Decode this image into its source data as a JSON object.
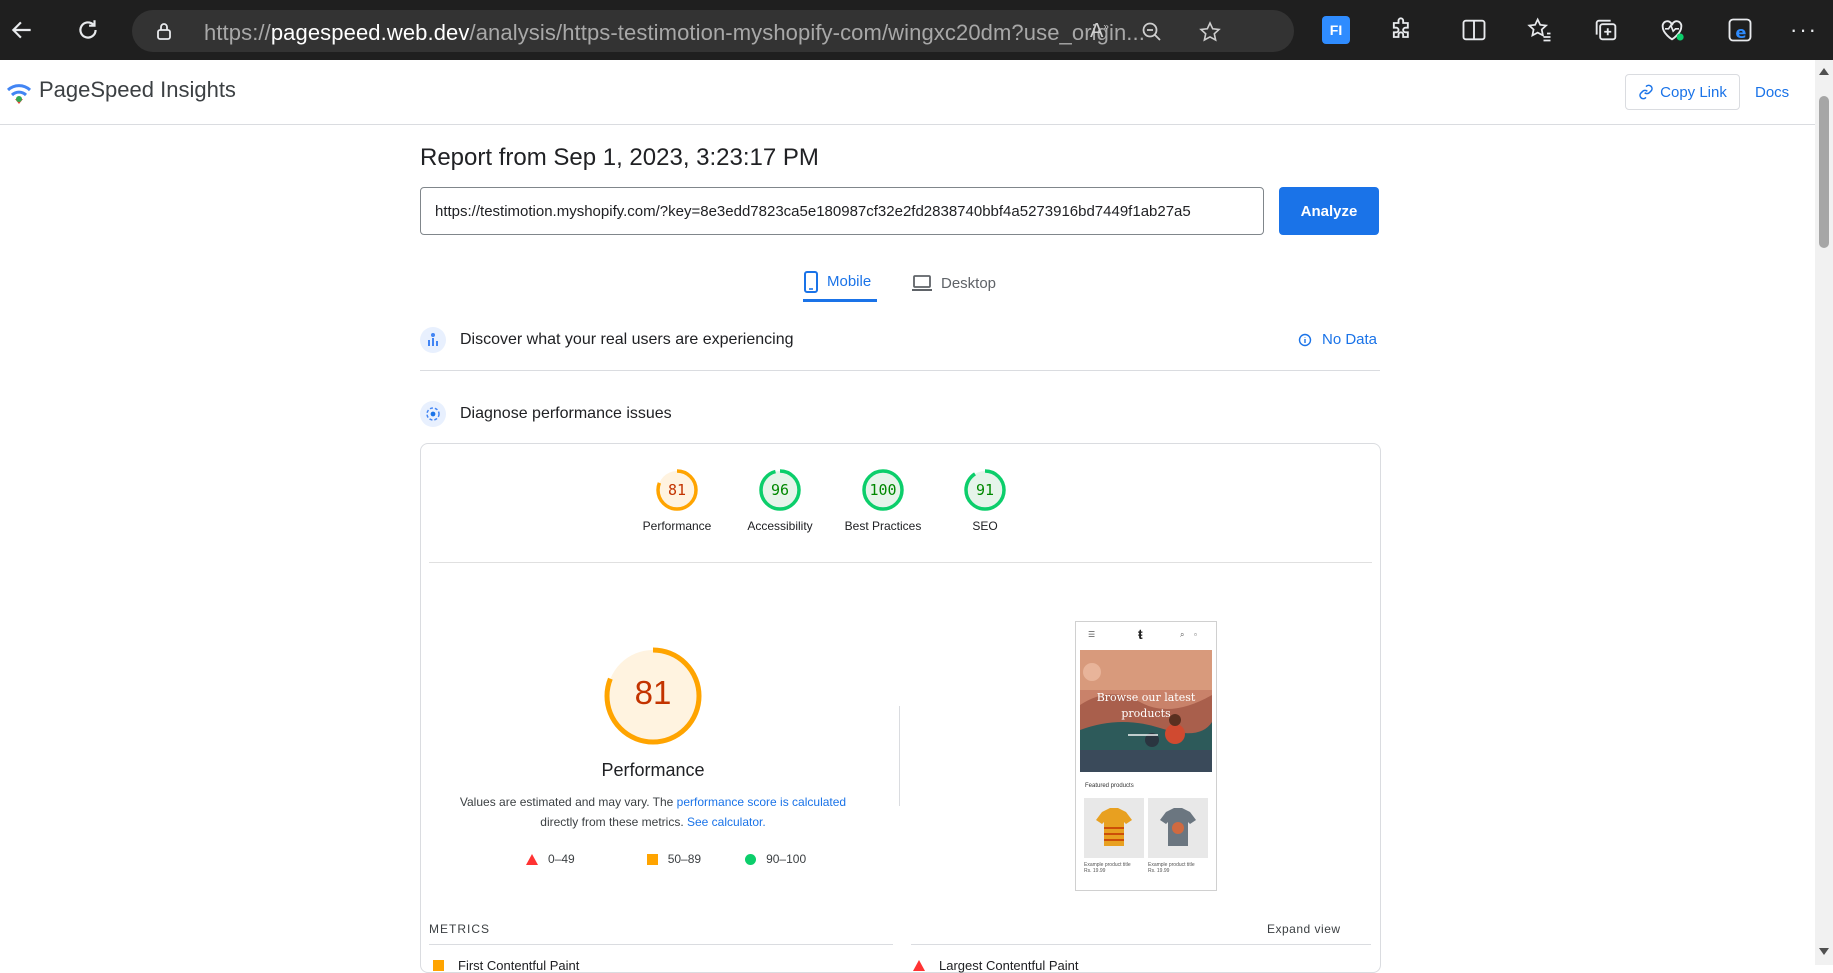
{
  "browser": {
    "url_prefix": "https://",
    "url_host": "pagespeed.web.dev",
    "url_rest": "/analysis/https-testimotion-myshopify-com/wingxc20dm?use_origin..."
  },
  "header": {
    "brand": "PageSpeed Insights",
    "copy_link": "Copy Link",
    "docs": "Docs"
  },
  "report": {
    "title": "Report from Sep 1, 2023, 3:23:17 PM",
    "url_value": "https://testimotion.myshopify.com/?key=8e3edd7823ca5e180987cf32e2fd2838740bbf4a5273916bd7449f1ab27a5",
    "analyze": "Analyze"
  },
  "tabs": {
    "mobile": "Mobile",
    "desktop": "Desktop"
  },
  "sections": {
    "discover": "Discover what your real users are experiencing",
    "no_data": "No Data",
    "diagnose": "Diagnose performance issues"
  },
  "scores": [
    {
      "label": "Performance",
      "value": "81",
      "score": 81,
      "color": "#ffa400",
      "text_color": "#c33300",
      "bg": "#fff3e0"
    },
    {
      "label": "Accessibility",
      "value": "96",
      "score": 96,
      "color": "#0cce6b",
      "text_color": "#008800",
      "bg": "#e6f4ea"
    },
    {
      "label": "Best Practices",
      "value": "100",
      "score": 100,
      "color": "#0cce6b",
      "text_color": "#008800",
      "bg": "#e6f4ea"
    },
    {
      "label": "SEO",
      "value": "91",
      "score": 91,
      "color": "#0cce6b",
      "text_color": "#008800",
      "bg": "#e6f4ea"
    }
  ],
  "performance": {
    "score": "81",
    "label": "Performance",
    "note_before": "Values are estimated and may vary. The ",
    "note_link1": "performance score is calculated",
    "note_middle": " directly from these metrics. ",
    "note_link2": "See calculator.",
    "legend": {
      "fail": "0–49",
      "average": "50–89",
      "pass": "90–100"
    }
  },
  "screenshot": {
    "hero_text": "Browse our latest products",
    "featured": "Featured products",
    "prod1_cap": "Example product title",
    "prod1_price": "Rs. 19.99",
    "prod2_cap": "Example product title",
    "prod2_price": "Rs. 19.99"
  },
  "metrics": {
    "heading": "METRICS",
    "expand": "Expand view",
    "fcp": "First Contentful Paint",
    "lcp": "Largest Contentful Paint"
  },
  "colors": {
    "accent": "#1a73e8",
    "average": "#ffa400",
    "pass": "#0cce6b",
    "fail": "#ff3333"
  }
}
